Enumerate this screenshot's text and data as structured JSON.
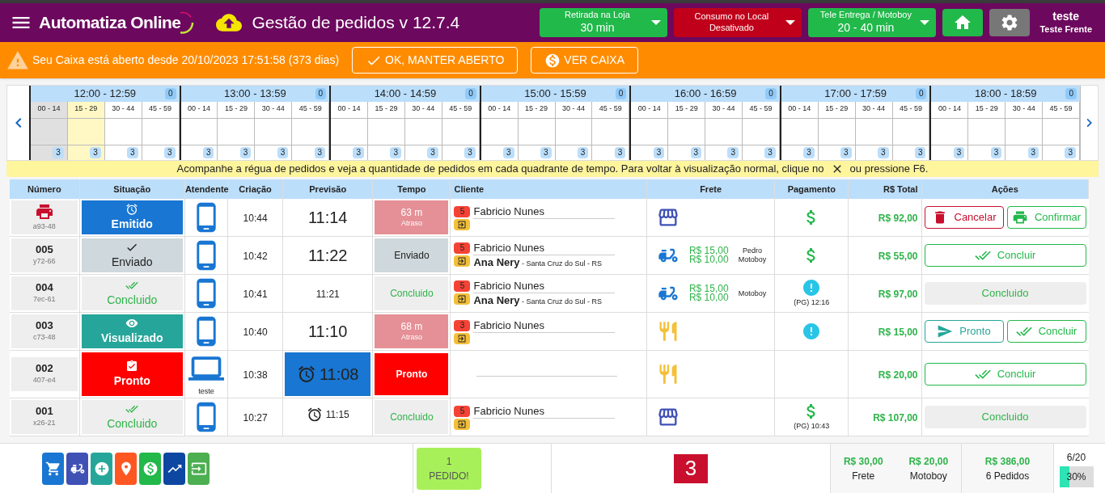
{
  "header": {
    "brand": "Automatiza Online",
    "app_title": "Gestão de pedidos v 12.7.4",
    "modes": [
      {
        "label": "Retirada na Loja",
        "value": "30 min",
        "active": true
      },
      {
        "label": "Consumo no Local",
        "value": "Desativado",
        "active": false
      },
      {
        "label": "Tele Entrega / Motoboy",
        "value": "20 - 40 min",
        "active": true
      }
    ],
    "user": {
      "name": "teste",
      "station": "Teste Frente"
    }
  },
  "alert": {
    "message": "Seu Caixa está aberto desde 20/10/2023 17:51:58 (373 dias)",
    "buttons": [
      {
        "kind": "confirm",
        "label": "OK, MANTER ABERTO"
      },
      {
        "kind": "cash",
        "label": "VER CAIXA"
      }
    ]
  },
  "timeline": {
    "hours": [
      {
        "label": "12:00 - 12:59",
        "count": "0",
        "quarters": [
          {
            "label": "00 - 14",
            "count": "3",
            "kind": "past"
          },
          {
            "label": "15 - 29",
            "count": "3",
            "kind": "current"
          },
          {
            "label": "30 - 44",
            "count": "3",
            "kind": "future"
          },
          {
            "label": "45 - 59",
            "count": "3",
            "kind": "future"
          }
        ]
      },
      {
        "label": "13:00 - 13:59",
        "count": "0",
        "quarters": [
          {
            "label": "00 - 14",
            "count": "3",
            "kind": "future"
          },
          {
            "label": "15 - 29",
            "count": "3",
            "kind": "future"
          },
          {
            "label": "30 - 44",
            "count": "3",
            "kind": "future"
          },
          {
            "label": "45 - 59",
            "count": "3",
            "kind": "future"
          }
        ]
      },
      {
        "label": "14:00 - 14:59",
        "count": "0",
        "quarters": [
          {
            "label": "00 - 14",
            "count": "3",
            "kind": "future"
          },
          {
            "label": "15 - 29",
            "count": "3",
            "kind": "future"
          },
          {
            "label": "30 - 44",
            "count": "3",
            "kind": "future"
          },
          {
            "label": "45 - 59",
            "count": "3",
            "kind": "future"
          }
        ]
      },
      {
        "label": "15:00 - 15:59",
        "count": "0",
        "quarters": [
          {
            "label": "00 - 14",
            "count": "3",
            "kind": "future"
          },
          {
            "label": "15 - 29",
            "count": "3",
            "kind": "future"
          },
          {
            "label": "30 - 44",
            "count": "3",
            "kind": "future"
          },
          {
            "label": "45 - 59",
            "count": "3",
            "kind": "future"
          }
        ]
      },
      {
        "label": "16:00 - 16:59",
        "count": "0",
        "quarters": [
          {
            "label": "00 - 14",
            "count": "3",
            "kind": "future"
          },
          {
            "label": "15 - 29",
            "count": "3",
            "kind": "future"
          },
          {
            "label": "30 - 44",
            "count": "3",
            "kind": "future"
          },
          {
            "label": "45 - 59",
            "count": "3",
            "kind": "future"
          }
        ]
      },
      {
        "label": "17:00 - 17:59",
        "count": "0",
        "quarters": [
          {
            "label": "00 - 14",
            "count": "3",
            "kind": "future"
          },
          {
            "label": "15 - 29",
            "count": "3",
            "kind": "future"
          },
          {
            "label": "30 - 44",
            "count": "3",
            "kind": "future"
          },
          {
            "label": "45 - 59",
            "count": "3",
            "kind": "future"
          }
        ]
      },
      {
        "label": "18:00 - 18:59",
        "count": "0",
        "quarters": [
          {
            "label": "00 - 14",
            "count": "3",
            "kind": "future"
          },
          {
            "label": "15 - 29",
            "count": "3",
            "kind": "future"
          },
          {
            "label": "30 - 44",
            "count": "3",
            "kind": "future"
          },
          {
            "label": "45 - 59",
            "count": "3",
            "kind": "future"
          }
        ]
      }
    ],
    "hint_before": "Acompanhe a régua de pedidos e veja a quantidade de pedidos em cada quadrante de tempo. Para voltar à visualização normal, clique no",
    "hint_after": "ou pressione F6."
  },
  "table": {
    "columns": [
      "Número",
      "Situação",
      "Atendente",
      "Criação",
      "Previsão",
      "Tempo",
      "Cliente",
      "Frete",
      "Pagamento",
      "R$ Total",
      "Ações"
    ],
    "rows": [
      {
        "code": "a93-48",
        "status": {
          "kind": "emitido",
          "label": "Emitido"
        },
        "attendant": {
          "kind": "phone"
        },
        "created": "10:44",
        "forecast": {
          "kind": "big",
          "text": "11:14"
        },
        "time": {
          "kind": "late",
          "text": "63 m",
          "sub": "Atraso"
        },
        "client": {
          "count": "5",
          "names": [
            {
              "name": "Fabricio Nunes"
            }
          ]
        },
        "freight": {
          "kind": "store"
        },
        "payment": {
          "kind": "cash"
        },
        "total": "R$ 92,00",
        "actions": [
          {
            "kind": "cancel",
            "label": "Cancelar"
          },
          {
            "kind": "print",
            "label": "Confirmar"
          }
        ]
      },
      {
        "number": "005",
        "code": "y72-66",
        "status": {
          "kind": "enviado",
          "label": "Enviado"
        },
        "attendant": {
          "kind": "phone"
        },
        "created": "10:42",
        "forecast": {
          "kind": "big",
          "text": "11:22"
        },
        "time": {
          "kind": "sent",
          "text": "Enviado"
        },
        "client": {
          "count": "5",
          "names": [
            {
              "name": "Fabricio Nunes"
            },
            {
              "name": "Ana Nery",
              "place": "- Santa Cruz do Sul - RS"
            }
          ]
        },
        "freight": {
          "kind": "moto",
          "prices": [
            "R$ 15,00",
            "R$ 10,00"
          ],
          "driver": [
            "Pedro",
            "Motoboy"
          ]
        },
        "payment": {
          "kind": "cash"
        },
        "total": "R$ 55,00",
        "actions": [
          {
            "kind": "done",
            "label": "Concluir"
          }
        ]
      },
      {
        "number": "004",
        "code": "7ec-61",
        "status": {
          "kind": "concluido",
          "label": "Concluido"
        },
        "attendant": {
          "kind": "phone"
        },
        "created": "10:41",
        "forecast": {
          "kind": "small",
          "text": "11:21"
        },
        "time": {
          "kind": "done",
          "text": "Concluido"
        },
        "client": {
          "count": "5",
          "names": [
            {
              "name": "Fabricio Nunes"
            },
            {
              "name": "Ana Nery",
              "place": "- Santa Cruz do Sul - RS"
            }
          ]
        },
        "freight": {
          "kind": "moto",
          "prices": [
            "R$ 15,00",
            "R$ 10,00"
          ],
          "driver": [
            "Motoboy"
          ]
        },
        "payment": {
          "kind": "pending",
          "note": "(PG) 12:16"
        },
        "total": "R$ 97,00",
        "actions": [
          {
            "kind": "finished",
            "label": "Concluido"
          }
        ]
      },
      {
        "number": "003",
        "code": "c73-48",
        "status": {
          "kind": "visualizado",
          "label": "Visualizado"
        },
        "attendant": {
          "kind": "phone"
        },
        "created": "10:40",
        "forecast": {
          "kind": "big",
          "text": "11:10"
        },
        "time": {
          "kind": "late",
          "text": "68 m",
          "sub": "Atraso"
        },
        "client": {
          "count": "3",
          "names": [
            {
              "name": "Fabricio Nunes"
            }
          ]
        },
        "freight": {
          "kind": "food"
        },
        "payment": {
          "kind": "pending"
        },
        "total": "R$ 15,00",
        "actions": [
          {
            "kind": "ready",
            "label": "Pronto"
          },
          {
            "kind": "done",
            "label": "Concluir"
          }
        ]
      },
      {
        "number": "002",
        "code": "407-e4",
        "status": {
          "kind": "pronto",
          "label": "Pronto"
        },
        "attendant": {
          "kind": "laptop",
          "name": "teste"
        },
        "created": "10:38",
        "forecast": {
          "kind": "highlight",
          "text": "11:08"
        },
        "time": {
          "kind": "ready",
          "text": "Pronto"
        },
        "freight": {
          "kind": "food"
        },
        "total": "R$ 20,00",
        "actions": [
          {
            "kind": "done",
            "label": "Concluir"
          }
        ]
      },
      {
        "number": "001",
        "code": "x26-21",
        "status": {
          "kind": "concluido",
          "label": "Concluido"
        },
        "attendant": {
          "kind": "phone"
        },
        "created": "10:27",
        "forecast": {
          "kind": "alarm",
          "text": "11:15"
        },
        "time": {
          "kind": "done",
          "text": "Concluido"
        },
        "client": {
          "count": "5",
          "names": [
            {
              "name": "Fabricio Nunes"
            }
          ]
        },
        "freight": {
          "kind": "store"
        },
        "payment": {
          "kind": "cash",
          "note": "(PG) 10:43"
        },
        "total": "R$ 107,00",
        "actions": [
          {
            "kind": "finished",
            "label": "Concluido"
          }
        ]
      }
    ]
  },
  "footer": {
    "tools": [
      {
        "kind": "cart",
        "color": "#1976d2"
      },
      {
        "kind": "moto",
        "color": "#3f51b5"
      },
      {
        "kind": "add",
        "color": "#26a69a"
      },
      {
        "kind": "pin",
        "color": "#ff5722"
      },
      {
        "kind": "money",
        "color": "#22b84a"
      },
      {
        "kind": "chart",
        "color": "#0d47a1"
      },
      {
        "kind": "queue",
        "color": "#4caf50"
      }
    ],
    "pending": {
      "count": "1",
      "label": "PEDIDO!"
    },
    "alert_count": "3",
    "freight": {
      "value": "R$ 30,00",
      "label": "Frete"
    },
    "motoboy": {
      "value": "R$ 20,00",
      "label": "Motoboy"
    },
    "total": {
      "value": "R$ 386,00",
      "label": "6 Pedidos"
    },
    "capacity": {
      "text": "6/20",
      "level": 0.3,
      "reading": "30%"
    }
  }
}
